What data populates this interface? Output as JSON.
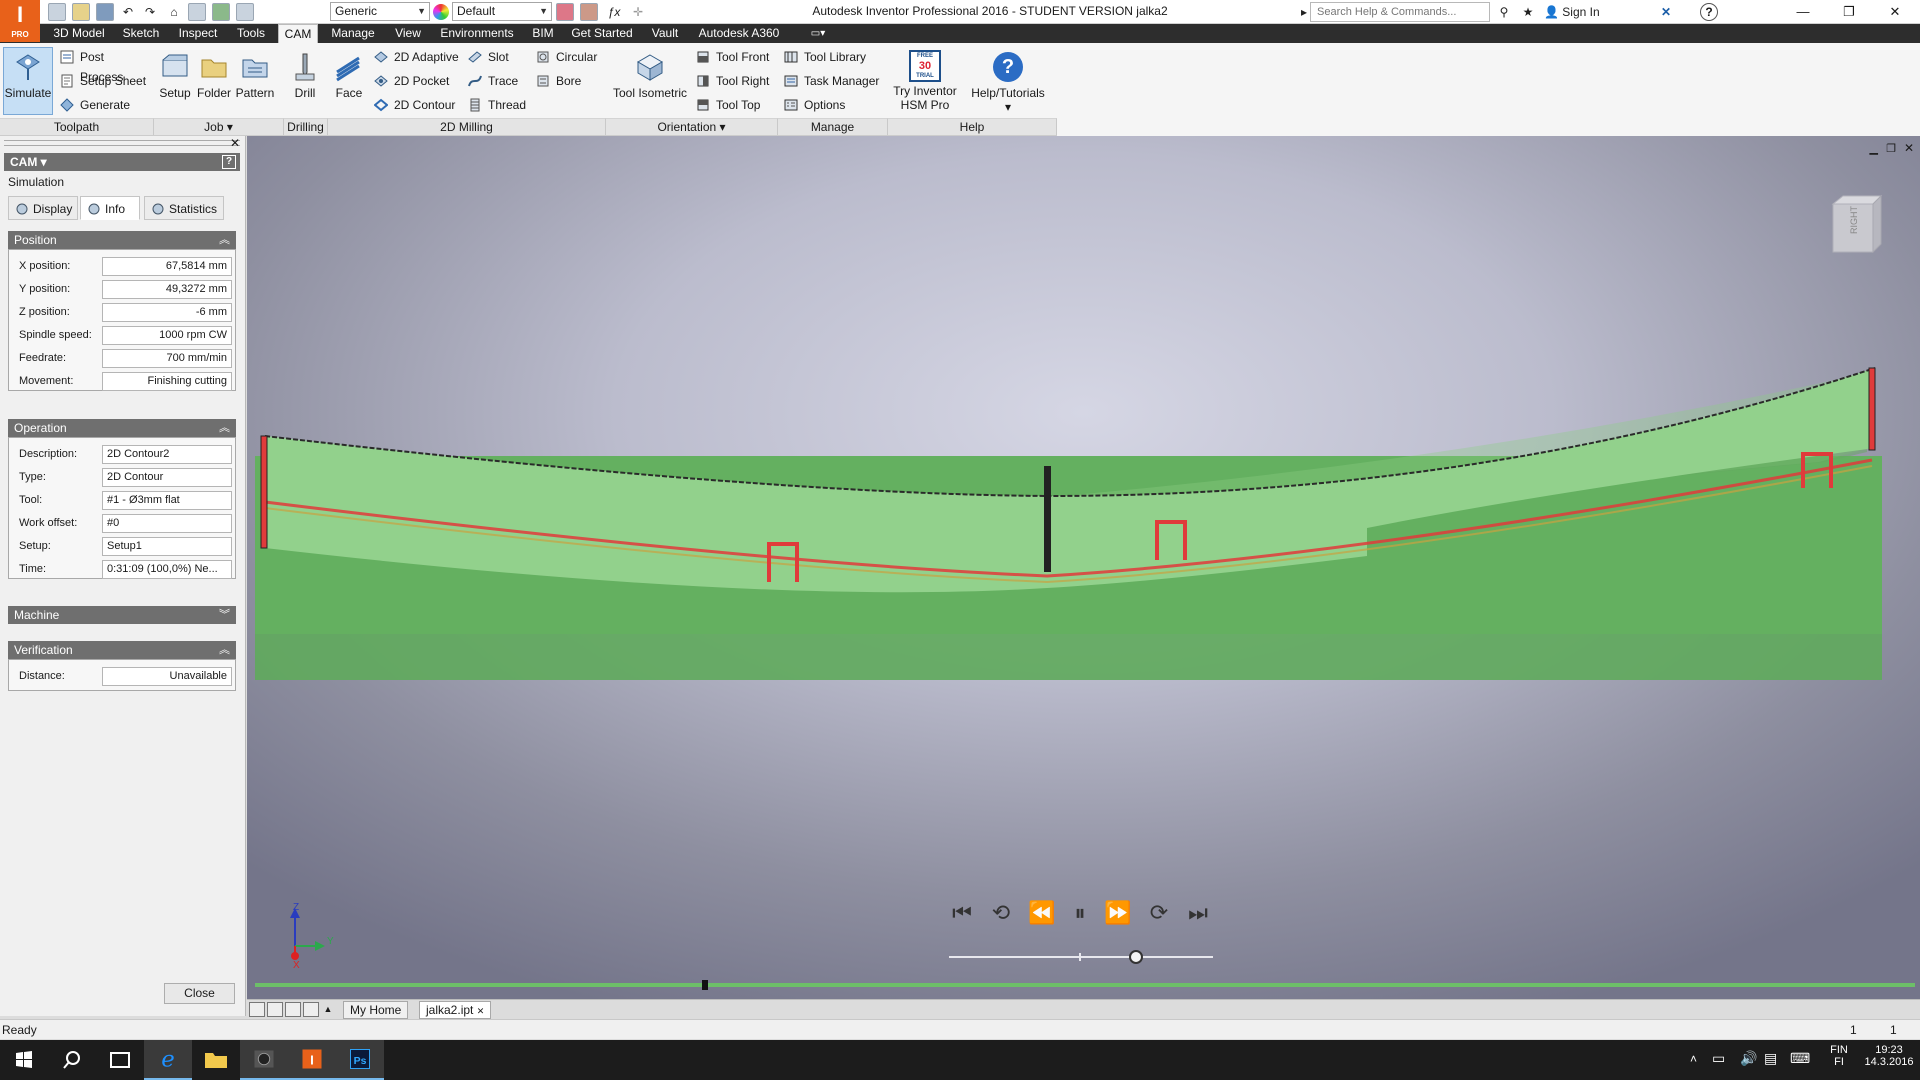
{
  "app": {
    "logo_letter": "I",
    "logo_sub": "PRO",
    "title": "Autodesk Inventor Professional 2016 - STUDENT VERSION   jalka2",
    "material_combo": "Generic",
    "appearance_combo": "Default",
    "search_placeholder": "Search Help & Commands...",
    "sign_in": "Sign In"
  },
  "tabs": [
    {
      "label": "3D Model"
    },
    {
      "label": "Sketch"
    },
    {
      "label": "Inspect"
    },
    {
      "label": "Tools"
    },
    {
      "label": "CAM"
    },
    {
      "label": "Manage"
    },
    {
      "label": "View"
    },
    {
      "label": "Environments"
    },
    {
      "label": "BIM"
    },
    {
      "label": "Get Started"
    },
    {
      "label": "Vault"
    },
    {
      "label": "Autodesk A360"
    }
  ],
  "ribbon": {
    "toolpath": {
      "simulate": "Simulate",
      "post_process": "Post Process",
      "setup_sheet": "Setup Sheet",
      "generate": "Generate",
      "group": "Toolpath"
    },
    "job": {
      "setup": "Setup",
      "folder": "Folder",
      "pattern": "Pattern",
      "group": "Job"
    },
    "drilling": {
      "drill": "Drill",
      "group": "Drilling"
    },
    "milling2d": {
      "face": "Face",
      "adaptive": "2D Adaptive",
      "pocket": "2D Pocket",
      "contour": "2D Contour",
      "slot": "Slot",
      "trace": "Trace",
      "thread": "Thread",
      "circular": "Circular",
      "bore": "Bore",
      "group": "2D Milling"
    },
    "orientation": {
      "tool_isometric": "Tool Isometric",
      "tool_front": "Tool Front",
      "tool_right": "Tool Right",
      "tool_top": "Tool Top",
      "group": "Orientation"
    },
    "manage": {
      "tool_library": "Tool Library",
      "task_manager": "Task Manager",
      "options": "Options",
      "group": "Manage"
    },
    "help": {
      "try_hsm_line1": "Try Inventor",
      "try_hsm_line2": "HSM Pro",
      "free_trial_badge1": "FREE",
      "free_trial_badge2": "30",
      "free_trial_badge3": "TRIAL",
      "tutorials": "Help/Tutorials",
      "group": "Help"
    }
  },
  "panel": {
    "header": "CAM",
    "subtitle": "Simulation",
    "tabs": [
      {
        "label": "Display"
      },
      {
        "label": "Info"
      },
      {
        "label": "Statistics"
      }
    ],
    "position": {
      "title": "Position",
      "fields": [
        {
          "label": "X position:",
          "value": "67,5814 mm"
        },
        {
          "label": "Y position:",
          "value": "49,3272 mm"
        },
        {
          "label": "Z position:",
          "value": "-6 mm"
        },
        {
          "label": "Spindle speed:",
          "value": "1000 rpm CW"
        },
        {
          "label": "Feedrate:",
          "value": "700 mm/min"
        },
        {
          "label": "Movement:",
          "value": "Finishing cutting"
        }
      ]
    },
    "operation": {
      "title": "Operation",
      "fields": [
        {
          "label": "Description:",
          "value": "2D Contour2"
        },
        {
          "label": "Type:",
          "value": "2D Contour"
        },
        {
          "label": "Tool:",
          "value": "#1 - Ø3mm flat"
        },
        {
          "label": "Work offset:",
          "value": "#0"
        },
        {
          "label": "Setup:",
          "value": "Setup1"
        },
        {
          "label": "Time:",
          "value": "0:31:09 (100,0%) Ne..."
        }
      ]
    },
    "machine": {
      "title": "Machine"
    },
    "verification": {
      "title": "Verification",
      "fields": [
        {
          "label": "Distance:",
          "value": "Unavailable"
        }
      ]
    },
    "close": "Close"
  },
  "viewport": {
    "viewcube_face": "RIGHT",
    "axis_z": "Z",
    "axis_x": "X",
    "axis_y": "Y",
    "timeline_progress": 0.27,
    "speed_slider_level": 0.72
  },
  "docs": {
    "home": "My Home",
    "file": "jalka2.ipt"
  },
  "status": {
    "text": "Ready",
    "num1": "1",
    "num2": "1"
  },
  "taskbar": {
    "lang1": "FIN",
    "lang2": "FI",
    "time": "19:23",
    "date": "14.3.2016"
  },
  "colors": {
    "accent_orange": "#e8611a",
    "stock_green": "#5faa5c",
    "part_light_green": "#92d18c",
    "toolpath_red": "#e03b3b"
  }
}
